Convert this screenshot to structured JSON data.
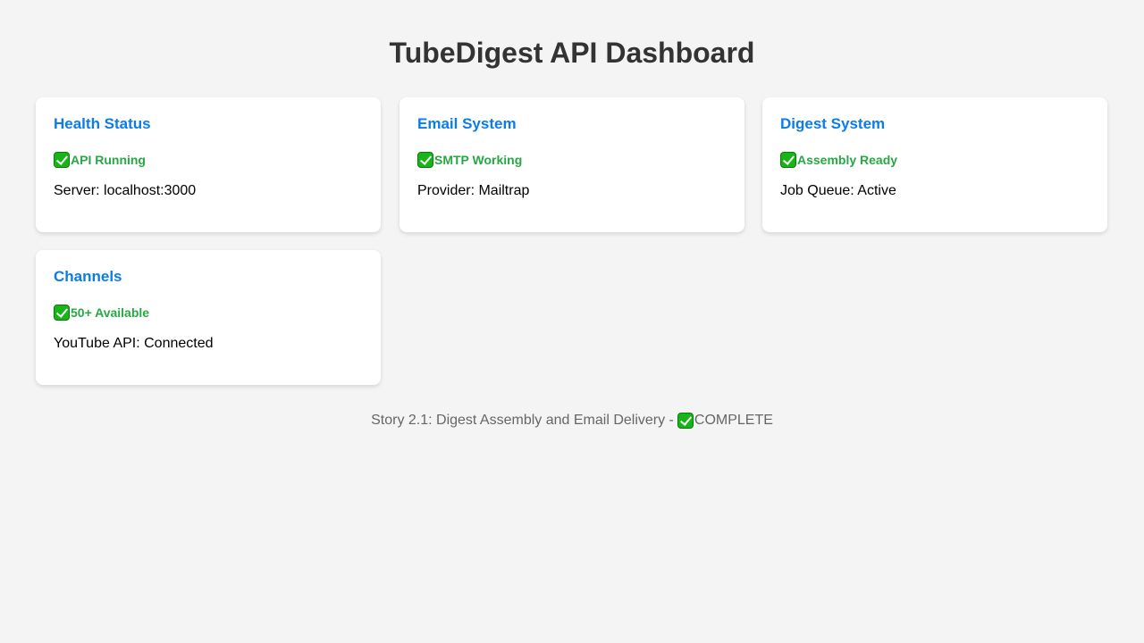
{
  "page": {
    "title": "TubeDigest API Dashboard"
  },
  "colors": {
    "background": "#f4f4f4",
    "card_title": "#0b7cea",
    "status_ok": "#28a745",
    "title_text": "#333333",
    "footer_text": "#666666"
  },
  "cards": [
    {
      "title": "Health Status",
      "status_icon": "check-mark-icon",
      "status": "API Running",
      "detail": "Server: localhost:3000"
    },
    {
      "title": "Email System",
      "status_icon": "check-mark-icon",
      "status": "SMTP Working",
      "detail": "Provider: Mailtrap"
    },
    {
      "title": "Digest System",
      "status_icon": "check-mark-icon",
      "status": "Assembly Ready",
      "detail": "Job Queue: Active"
    },
    {
      "title": "Channels",
      "status_icon": "check-mark-icon",
      "status": "50+ Available",
      "detail": "YouTube API: Connected"
    }
  ],
  "footer": {
    "prefix": "Story 2.1: Digest Assembly and Email Delivery -",
    "icon": "check-mark-icon",
    "suffix": "COMPLETE"
  }
}
